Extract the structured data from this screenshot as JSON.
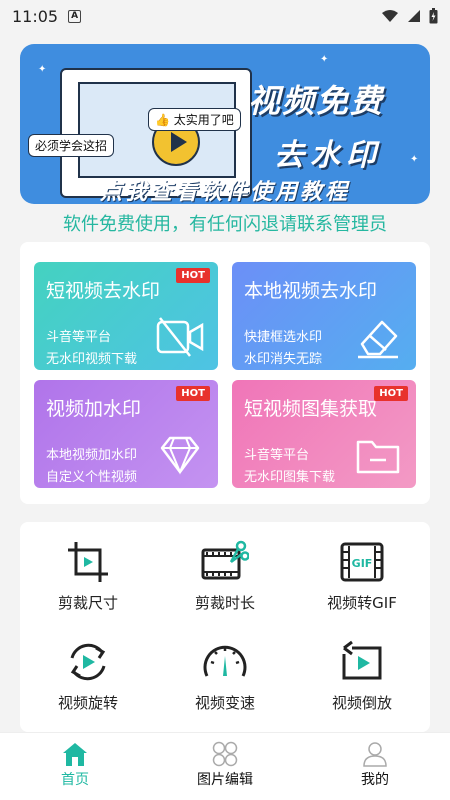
{
  "status_bar": {
    "time": "11:05",
    "a_badge": "A"
  },
  "banner": {
    "bubble_top": "太实用了吧",
    "bubble_left": "必须学会这招",
    "title_line1": "视频免费",
    "title_line2": "去水印",
    "subtitle": "点我查看软件使用教程"
  },
  "notice": "软件免费使用，有任何闪退请联系管理员",
  "cards": [
    {
      "title": "短视频去水印",
      "line1": "斗音等平台",
      "line2": "无水印视频下载",
      "badge": "HOT",
      "icon": "video-off-icon"
    },
    {
      "title": "本地视频去水印",
      "line1": "快捷框选水印",
      "line2": "水印消失无踪",
      "badge": "",
      "icon": "eraser-icon"
    },
    {
      "title": "视频加水印",
      "line1": "本地视频加水印",
      "line2": "自定义个性视频",
      "badge": "HOT",
      "icon": "diamond-icon"
    },
    {
      "title": "短视频图集获取",
      "line1": "斗音等平台",
      "line2": "无水印图集下载",
      "badge": "HOT",
      "icon": "folder-icon"
    }
  ],
  "tools": [
    {
      "label": "剪裁尺寸",
      "icon": "crop-icon"
    },
    {
      "label": "剪裁时长",
      "icon": "film-scissors-icon"
    },
    {
      "label": "视频转GIF",
      "icon": "gif-film-icon"
    },
    {
      "label": "视频旋转",
      "icon": "rotate-play-icon"
    },
    {
      "label": "视频变速",
      "icon": "speedometer-icon"
    },
    {
      "label": "视频倒放",
      "icon": "reverse-play-icon"
    }
  ],
  "gif_text": "GIF",
  "nav": [
    {
      "label": "首页",
      "icon": "home-icon",
      "active": true
    },
    {
      "label": "图片编辑",
      "icon": "grid-icon",
      "active": false
    },
    {
      "label": "我的",
      "icon": "user-icon",
      "active": false
    }
  ],
  "colors": {
    "accent": "#1fb8a2",
    "hot": "#e8322c",
    "banner_bg": "#3f8ddf"
  }
}
